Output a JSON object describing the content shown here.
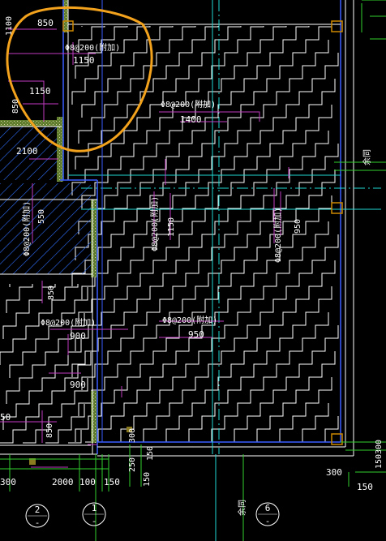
{
  "labels": {
    "top_850": "850",
    "left_1100": "1100",
    "rebar_top": "Φ8@200(附加)",
    "d_1150_a": "1150",
    "d_1150_b": "1150",
    "left_850": "850",
    "rebar_mid": "Φ8@200(附加)",
    "d_1400": "1400",
    "d_2100": "2100",
    "rebar_left_v": "Φ8@200(附加)",
    "d_550": "550",
    "rebar_center_v": "Φ8@200(附加)",
    "d_1150_v": "1150",
    "rebar_right_v": "Φ8@200(附加)",
    "d_950_v": "950",
    "d_850_v": "850",
    "rebar_left_b": "Φ8@200(附加)",
    "d_900_a": "900",
    "rebar_bottom": "Φ8@200(附加)",
    "d_950_b": "950",
    "d_900_b": "900",
    "d_50": "50",
    "d_850_v2": "850",
    "d_300_v": "300",
    "d_150_v": "150",
    "d_250_v": "250",
    "d_150_v2": "150",
    "d_300_b": "300",
    "d_2000": "2000",
    "d_100": "100",
    "d_150_b": "150",
    "d_300_r": "300",
    "d_150_r": "150",
    "d_150_rv": "150",
    "d_300_rv": "300",
    "side_label": "余同",
    "bottom_label": "余同"
  },
  "axes": [
    {
      "name": "axis-2",
      "label": "2"
    },
    {
      "name": "axis-1",
      "label": "1"
    },
    {
      "name": "axis-6",
      "label": "6"
    }
  ],
  "colors": {
    "background": "#000000",
    "slab_edge": "#3a5cff",
    "wall": "#ffffff",
    "column": "#cc8800",
    "rebar": "#ffffff",
    "dim_line": "#c03cc0",
    "grid_line": "#21d8d0",
    "green_line": "#2fcf2f",
    "hatch": "#2f6fff",
    "highlight": "#f2a21c",
    "filled_wall": "#7a9a3a"
  }
}
